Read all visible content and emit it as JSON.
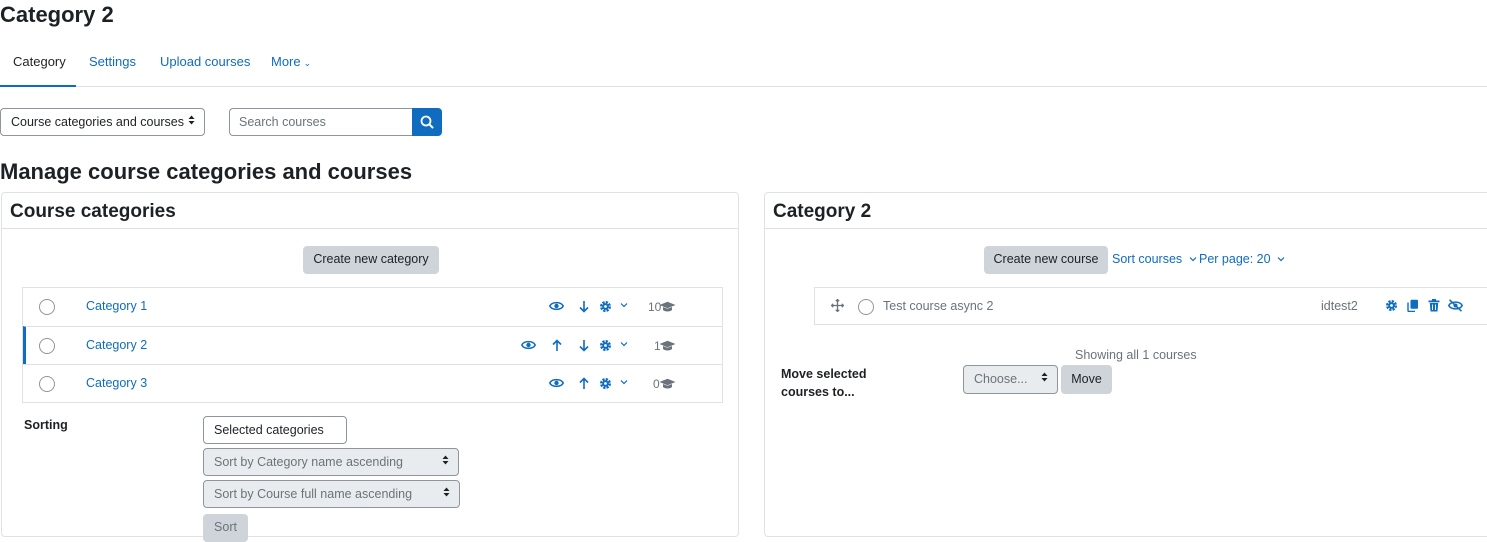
{
  "page": {
    "title": "Category 2"
  },
  "tabs": [
    {
      "label": "Category",
      "active": true
    },
    {
      "label": "Settings"
    },
    {
      "label": "Upload courses"
    },
    {
      "label": "More",
      "has_dropdown": true
    }
  ],
  "view_select": {
    "value": "Course categories and courses"
  },
  "search": {
    "placeholder": "Search courses",
    "button_icon": "search-icon"
  },
  "main": {
    "heading": "Manage course categories and courses"
  },
  "categories_panel": {
    "title": "Course categories",
    "create_button": "Create new category",
    "rows": [
      {
        "name": "Category 1",
        "count": "10",
        "actions": [
          "eye-icon",
          "arrow-down-icon",
          "gear-icon",
          "chevron-down-icon"
        ]
      },
      {
        "name": "Category 2",
        "count": "1",
        "active": true,
        "actions": [
          "eye-icon",
          "arrow-up-icon",
          "arrow-down-icon",
          "gear-icon",
          "chevron-down-icon"
        ]
      },
      {
        "name": "Category 3",
        "count": "0",
        "actions": [
          "eye-icon",
          "arrow-up-icon",
          "gear-icon",
          "chevron-down-icon"
        ]
      }
    ],
    "sorting": {
      "label": "Sorting",
      "scope_select": "Selected categories",
      "category_sort_select": "Sort by Category name ascending",
      "course_sort_select": "Sort by Course full name ascending",
      "sort_button": "Sort"
    }
  },
  "courses_panel": {
    "title": "Category 2",
    "create_button": "Create new course",
    "sort_link": "Sort courses",
    "per_page_link": "Per page: 20",
    "courses": [
      {
        "name": "Test course async 2",
        "idnumber": "idtest2",
        "actions": [
          "gear-icon",
          "copy-icon",
          "trash-icon",
          "eye-slash-icon"
        ]
      }
    ],
    "showing_text": "Showing all 1 courses",
    "move_label": "Move selected courses to...",
    "move_select": "Choose...",
    "move_button": "Move"
  },
  "colors": {
    "primary": "#0f6cbf",
    "text": "#1d2125",
    "border": "#dee2e6",
    "secondary_btn": "#ced4da"
  }
}
